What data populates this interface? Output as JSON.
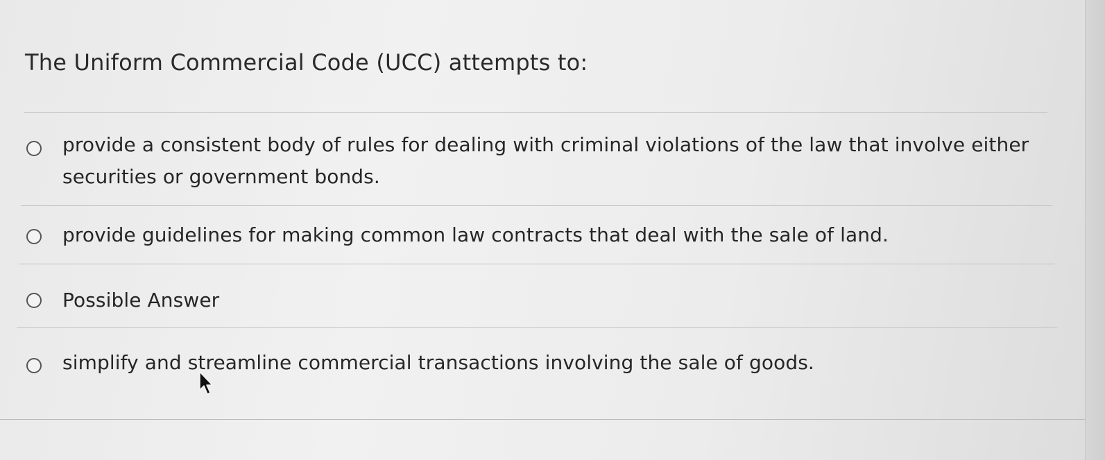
{
  "question": {
    "text": "The Uniform Commercial Code (UCC) attempts to:"
  },
  "options": [
    {
      "label": "provide a consistent body of rules for dealing with criminal violations of the law that involve either securities or government bonds.",
      "selected": false
    },
    {
      "label": "provide guidelines for making common law contracts that deal with the sale of land.",
      "selected": false
    },
    {
      "label": "Possible Answer",
      "selected": false
    },
    {
      "label": "simplify and streamline commercial transactions involving the sale of goods.",
      "selected": false
    }
  ],
  "icons": {
    "radio": "radio-button-icon",
    "cursor": "mouse-pointer-icon"
  },
  "colors": {
    "text": "#262626",
    "radio_border": "#555555",
    "divider": "#c2c2c2"
  }
}
